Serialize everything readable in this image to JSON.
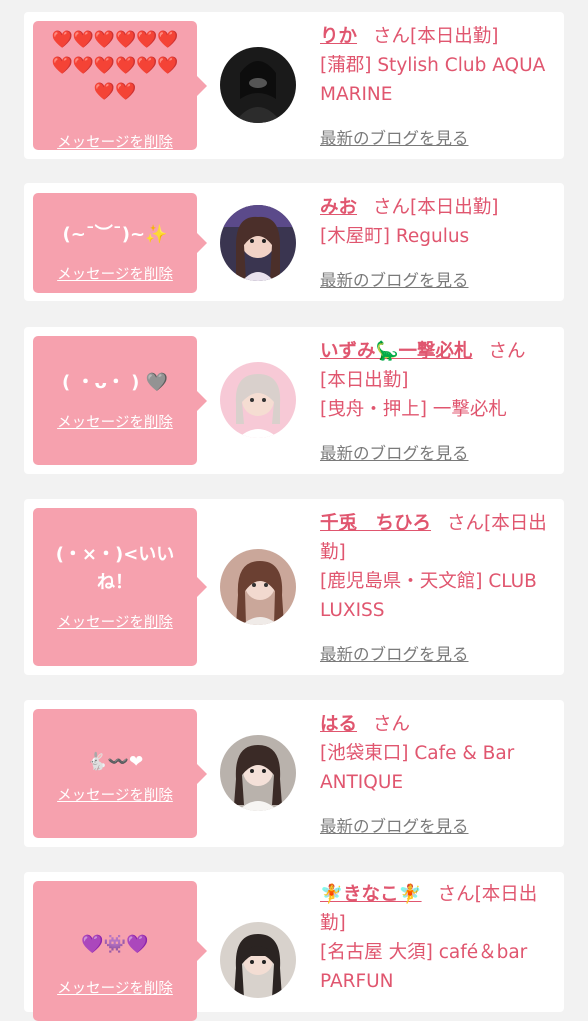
{
  "common": {
    "delete_label": "メッセージを削除",
    "blog_label": "最新のブログを見る",
    "san": "さん",
    "on_duty": "[本日出勤]"
  },
  "entries": [
    {
      "message": "❤️❤️❤️❤️❤️❤️\n❤️❤️❤️❤️❤️❤️\n❤️❤️",
      "name": "りか",
      "location": "[蒲郡] Stylish Club AQUA MARINE"
    },
    {
      "message": "(~ˉ︶ˉ)~✨",
      "name": "みお",
      "location": "[木屋町] Regulus"
    },
    {
      "message": "( ・ᴗ・ ) 🩶",
      "name": "いずみ🦕一撃必札",
      "location": "[曳舟・押上] 一撃必札"
    },
    {
      "message": "(・×・)<いい\nね！",
      "name": "千兎　ちひろ",
      "location": "[鹿児島県・天文館] CLUB LUXISS"
    },
    {
      "message": "🐇〰️❤",
      "name": "はる",
      "location": "[池袋東口] Cafe & Bar ANTIQUE"
    },
    {
      "message": "💜👾💜",
      "name": "🧚きなこ🧚",
      "location": "[名古屋 大須] café＆bar PARFUN"
    }
  ],
  "colors": {
    "bubble": "#f6a1ae",
    "accent": "#e0566f",
    "link_gray": "#7a7a7a",
    "background": "#f2f2f2"
  }
}
